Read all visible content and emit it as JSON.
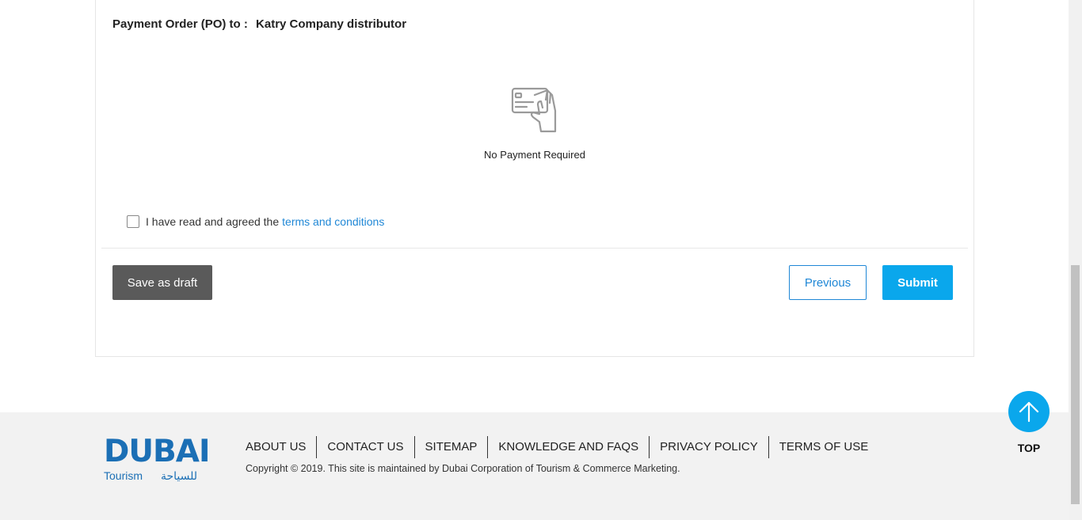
{
  "payment_order": {
    "label": "Payment Order (PO) to :",
    "value": "Katry Company distributor"
  },
  "payment_status": {
    "icon": "credit-card-hand-icon",
    "text": "No Payment Required"
  },
  "terms": {
    "checked": false,
    "text": "I have read and agreed the",
    "link_text": "terms and conditions"
  },
  "actions": {
    "save_draft": "Save as draft",
    "previous": "Previous",
    "submit": "Submit"
  },
  "footer": {
    "logo": {
      "brand": "DUBAI",
      "tagline_en": "Tourism",
      "tagline_ar": "للسياحة"
    },
    "links": [
      "ABOUT US",
      "CONTACT US",
      "SITEMAP",
      "KNOWLEDGE AND FAQS",
      "PRIVACY POLICY",
      "TERMS OF USE"
    ],
    "copyright": "Copyright © 2019. This site is maintained by Dubai Corporation of Tourism & Commerce Marketing."
  },
  "back_to_top": {
    "label": "TOP",
    "icon": "arrow-up-icon"
  },
  "colors": {
    "primary": "#0aa7ec",
    "link": "#1f87d6",
    "draft_button": "#5a5a5a",
    "footer_bg": "#f2f2f2",
    "logo": "#1b6fb5"
  }
}
